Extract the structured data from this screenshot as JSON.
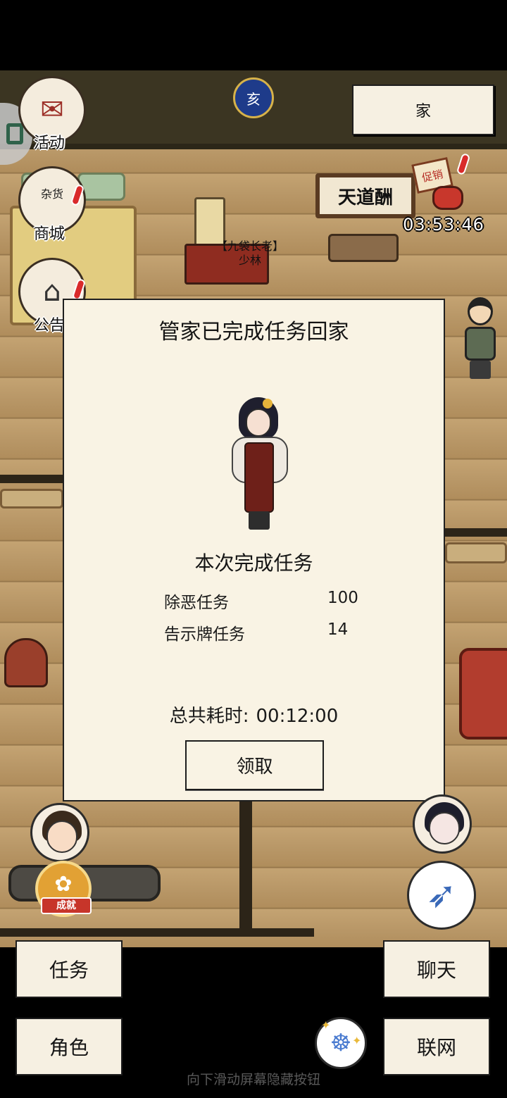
{
  "top_left": {
    "activity_label": "活动",
    "shop_label": "商城",
    "notice_label": "公告",
    "shop_sign": "杂货"
  },
  "time_badge": "亥",
  "home_button": "家",
  "scene": {
    "sign_text": "天道酬",
    "promo_tag": "促销",
    "promo_timer": "03:53:46",
    "npc_title": "【九袋长老】",
    "npc_name": "少林"
  },
  "dialog": {
    "title": "管家已完成任务回家",
    "completed_title": "本次完成任务",
    "tasks": [
      {
        "name": "除恶任务",
        "count": "100"
      },
      {
        "name": "告示牌任务",
        "count": "14"
      }
    ],
    "total_time_label": "总共耗时:",
    "total_time_value": "00:12:00",
    "claim_button": "领取"
  },
  "achievement_label": "成就",
  "bottom_menu": {
    "task": "任务",
    "character": "角色",
    "chat": "聊天",
    "network": "联网"
  },
  "hint": "向下滑动屏幕隐藏按钮",
  "colors": {
    "panel_bg": "#f9f3e4",
    "wall": "#3b3522",
    "floor": "#b99868",
    "accent_red": "#d92a2a"
  }
}
